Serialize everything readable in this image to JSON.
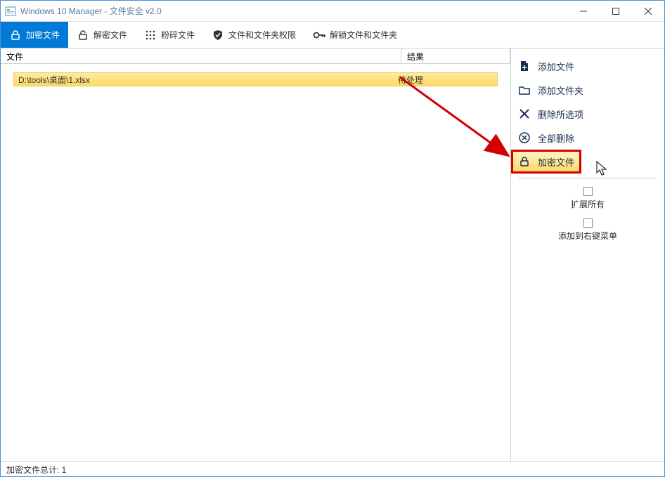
{
  "window": {
    "title": "Windows 10 Manager - 文件安全 v2.0"
  },
  "toolbar": {
    "tabs": [
      {
        "label": "加密文件",
        "active": true
      },
      {
        "label": "解密文件"
      },
      {
        "label": "粉碎文件"
      },
      {
        "label": "文件和文件夹权限"
      },
      {
        "label": "解锁文件和文件夹"
      }
    ]
  },
  "columns": {
    "file": "文件",
    "result": "结果"
  },
  "rows": [
    {
      "file": "D:\\tools\\桌面\\1.xlsx",
      "result": "待处理"
    }
  ],
  "side": {
    "add_file": "添加文件",
    "add_folder": "添加文件夹",
    "delete_selected": "删除所选项",
    "delete_all": "全部删除",
    "encrypt": "加密文件",
    "expand_all": "扩展所有",
    "add_context_menu": "添加到右键菜单"
  },
  "status": {
    "text": "加密文件总计: 1"
  }
}
